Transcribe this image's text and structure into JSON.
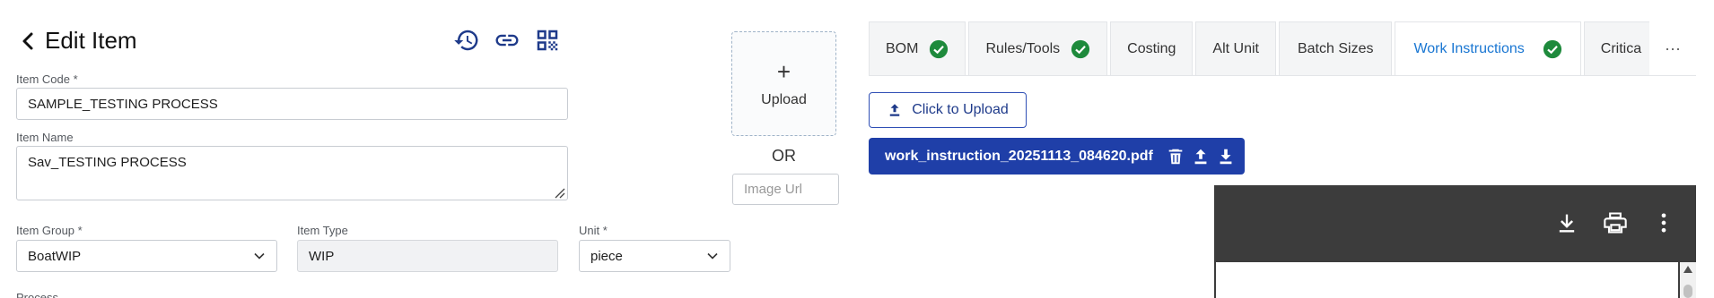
{
  "header": {
    "title": "Edit Item",
    "icons": [
      "back-arrow-icon",
      "history-icon",
      "link-icon",
      "qr-code-icon"
    ]
  },
  "form": {
    "item_code": {
      "label": "Item Code *",
      "value": "SAMPLE_TESTING PROCESS"
    },
    "item_name": {
      "label": "Item Name",
      "value": "Sav_TESTING PROCESS"
    },
    "item_group": {
      "label": "Item Group *",
      "value": "BoatWIP"
    },
    "item_type": {
      "label": "Item Type",
      "value": "WIP"
    },
    "unit": {
      "label": "Unit *",
      "value": "piece"
    },
    "process_label": "Process"
  },
  "image_upload": {
    "upload_label": "Upload",
    "or_text": "OR",
    "image_url_placeholder": "Image Url"
  },
  "tabs": [
    {
      "label": "BOM",
      "checked": true,
      "active": false
    },
    {
      "label": "Rules/Tools",
      "checked": true,
      "active": false
    },
    {
      "label": "Costing",
      "checked": false,
      "active": false
    },
    {
      "label": "Alt Unit",
      "checked": false,
      "active": false
    },
    {
      "label": "Batch Sizes",
      "checked": false,
      "active": false
    },
    {
      "label": "Work Instructions",
      "checked": true,
      "active": true
    },
    {
      "label": "Critica",
      "checked": false,
      "active": false
    }
  ],
  "tabs_more": "···",
  "work_instructions": {
    "click_to_upload_label": "Click to Upload",
    "file_name": "work_instruction_20251113_084620.pdf"
  },
  "colors": {
    "accent_blue": "#1976d2",
    "chip_blue": "#1f3fa8",
    "check_green": "#1e8a3c",
    "pdf_toolbar": "#3c3c3c"
  }
}
